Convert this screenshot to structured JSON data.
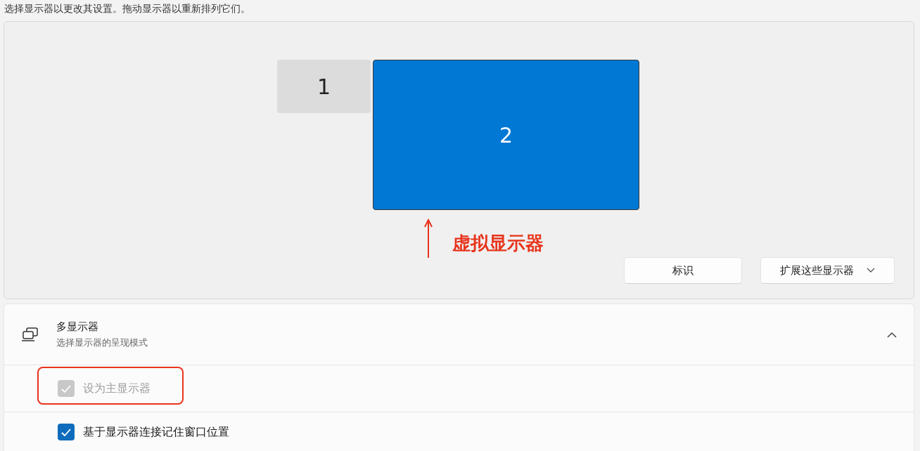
{
  "instruction": "选择显示器以更改其设置。拖动显示器以重新排列它们。",
  "arrangement": {
    "monitors": [
      {
        "label": "1",
        "selected": false
      },
      {
        "label": "2",
        "selected": true
      }
    ],
    "annotation": {
      "text": "虚拟显示器"
    },
    "identify_button": "标识",
    "mode_dropdown": {
      "value": "扩展这些显示器"
    }
  },
  "multiple_displays": {
    "title": "多显示器",
    "subtitle": "选择显示器的呈现模式",
    "expanded": true,
    "options": [
      {
        "label": "设为主显示器",
        "checked": true,
        "disabled": true,
        "highlighted": true
      },
      {
        "label": "基于显示器连接记住窗口位置",
        "checked": true,
        "disabled": false,
        "highlighted": false
      }
    ]
  }
}
